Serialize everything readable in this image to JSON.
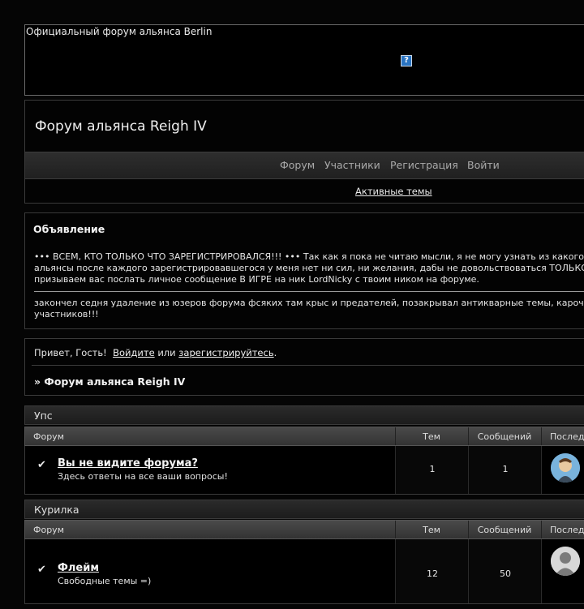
{
  "banner": {
    "text": "Официальный форум альянса Berlin",
    "icon": "help-question-icon"
  },
  "header": {
    "title": "Форум альянса Reigh IV",
    "menu": [
      "Форум",
      "Участники",
      "Регистрация",
      "Войти"
    ],
    "active_topics": "Активные темы"
  },
  "announcement": {
    "title": "Объявление",
    "line1": "••• ВСЕМ, КТО ТОЛЬКО ЧТО ЗАРЕГИСТРИРОВАЛСЯ!!! ••• Так как я пока не читаю мысли, я не могу узнать из какого",
    "line2": "альянсы после каждого зарегистрировавшегося у меня нет ни сил, ни желания, дабы не довольствоваться ТОЛЬКО",
    "line3": "призываем вас послать личное сообщение В ИГРЕ на ник LordNicky с твоим ником на форуме.",
    "line4": "закончел седня удаление из юзеров форума фсяких там крыс и предателей, позакрывал антикварные темы, карочь",
    "line5": "участников!!!"
  },
  "welcome": {
    "greeting": "Привет, Гость!",
    "login": "Войдите",
    "or": "или",
    "register": "зарегистрируйтесь",
    "dot": ".",
    "crumb": "» Форум альянса Reigh IV"
  },
  "categories": [
    {
      "name": "Упс",
      "headers": {
        "forum": "Форум",
        "topics": "Тем",
        "posts": "Сообщений",
        "last": "Послед"
      },
      "forums": [
        {
          "name": "Вы не видите форума?",
          "desc": "Здесь ответы на все ваши вопросы!",
          "topics": "1",
          "posts": "1",
          "check": "✔"
        }
      ]
    },
    {
      "name": "Курилка",
      "headers": {
        "forum": "Форум",
        "topics": "Тем",
        "posts": "Сообщений",
        "last": "Послед"
      },
      "forums": [
        {
          "name": "Флейм",
          "desc": "Свободные темы =)",
          "topics": "12",
          "posts": "50",
          "check": "✔"
        }
      ]
    }
  ]
}
